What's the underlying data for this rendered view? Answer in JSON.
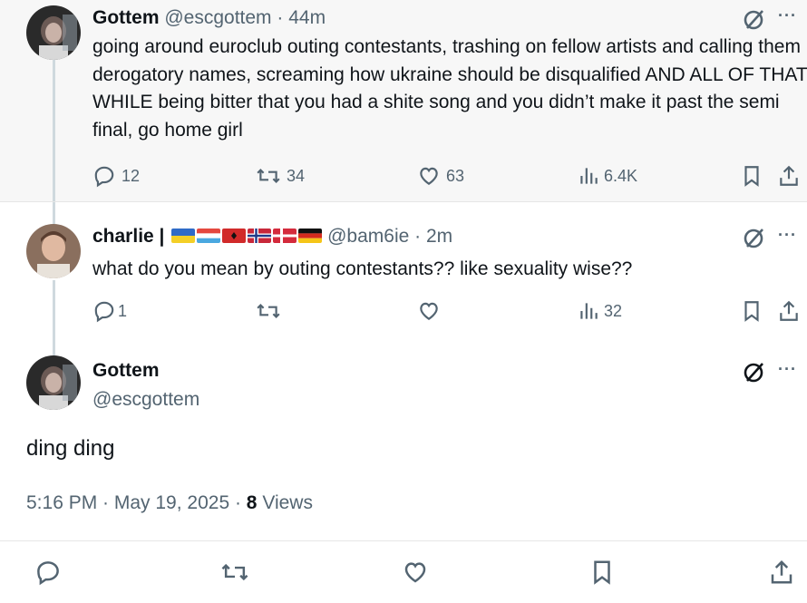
{
  "tweets": [
    {
      "name": "Gottem",
      "handle": "@escgottem",
      "separator": "·",
      "time": "44m",
      "text": "going around euroclub outing contestants, trashing on fellow artists and calling them derogatory names, screaming how ukraine should be disqualified AND ALL OF THAT WHILE being bitter that you had a shite song and you didn’t make it past the semi final, go home girl",
      "replies": "12",
      "reposts": "34",
      "likes": "63",
      "views": "6.4K"
    },
    {
      "name": "charlie |",
      "flags": [
        "ukraine",
        "luxembourg",
        "albania",
        "norway",
        "denmark",
        "germany"
      ],
      "handle": "@bam6ie",
      "separator": "·",
      "time": "2m",
      "text": "what do you mean by outing contestants?? like sexuality wise??",
      "replies": "1",
      "reposts": "",
      "likes": "",
      "views": "32"
    },
    {
      "name": "Gottem",
      "handle": "@escgottem",
      "text": "ding ding",
      "timestamp": "5:16 PM · May 19, 2025 · ",
      "views_count": "8",
      "views_label": " Views"
    }
  ],
  "more_label": "···",
  "icons": [
    "reply-icon",
    "repost-icon",
    "like-icon",
    "views-icon",
    "bookmark-icon",
    "share-icon",
    "grok-icon"
  ],
  "colors": {
    "text": "#0f1419",
    "secondary": "#536471",
    "divider": "#e6e6e6",
    "thread": "#cfd9de"
  }
}
